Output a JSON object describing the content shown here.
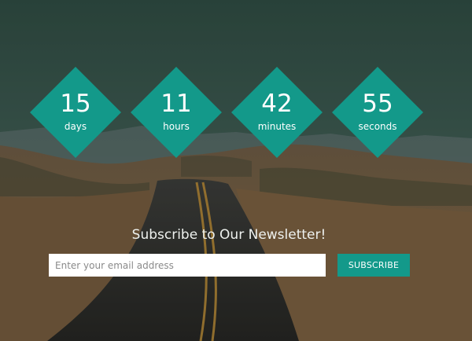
{
  "countdown": {
    "days": {
      "value": "15",
      "label": "days"
    },
    "hours": {
      "value": "11",
      "label": "hours"
    },
    "minutes": {
      "value": "42",
      "label": "minutes"
    },
    "seconds": {
      "value": "55",
      "label": "seconds"
    }
  },
  "newsletter": {
    "title": "Subscribe to Our Newsletter!",
    "email_placeholder": "Enter your email address",
    "email_value": "",
    "subscribe_label": "SUBSCRIBE"
  },
  "colors": {
    "accent": "#13998a",
    "sky_top": "#2f4a40",
    "sand": "#8a6a45",
    "road": "#2e2c2a",
    "road_line": "#c79a3a"
  },
  "background": {
    "image_semantic": "desert-road-landscape"
  }
}
